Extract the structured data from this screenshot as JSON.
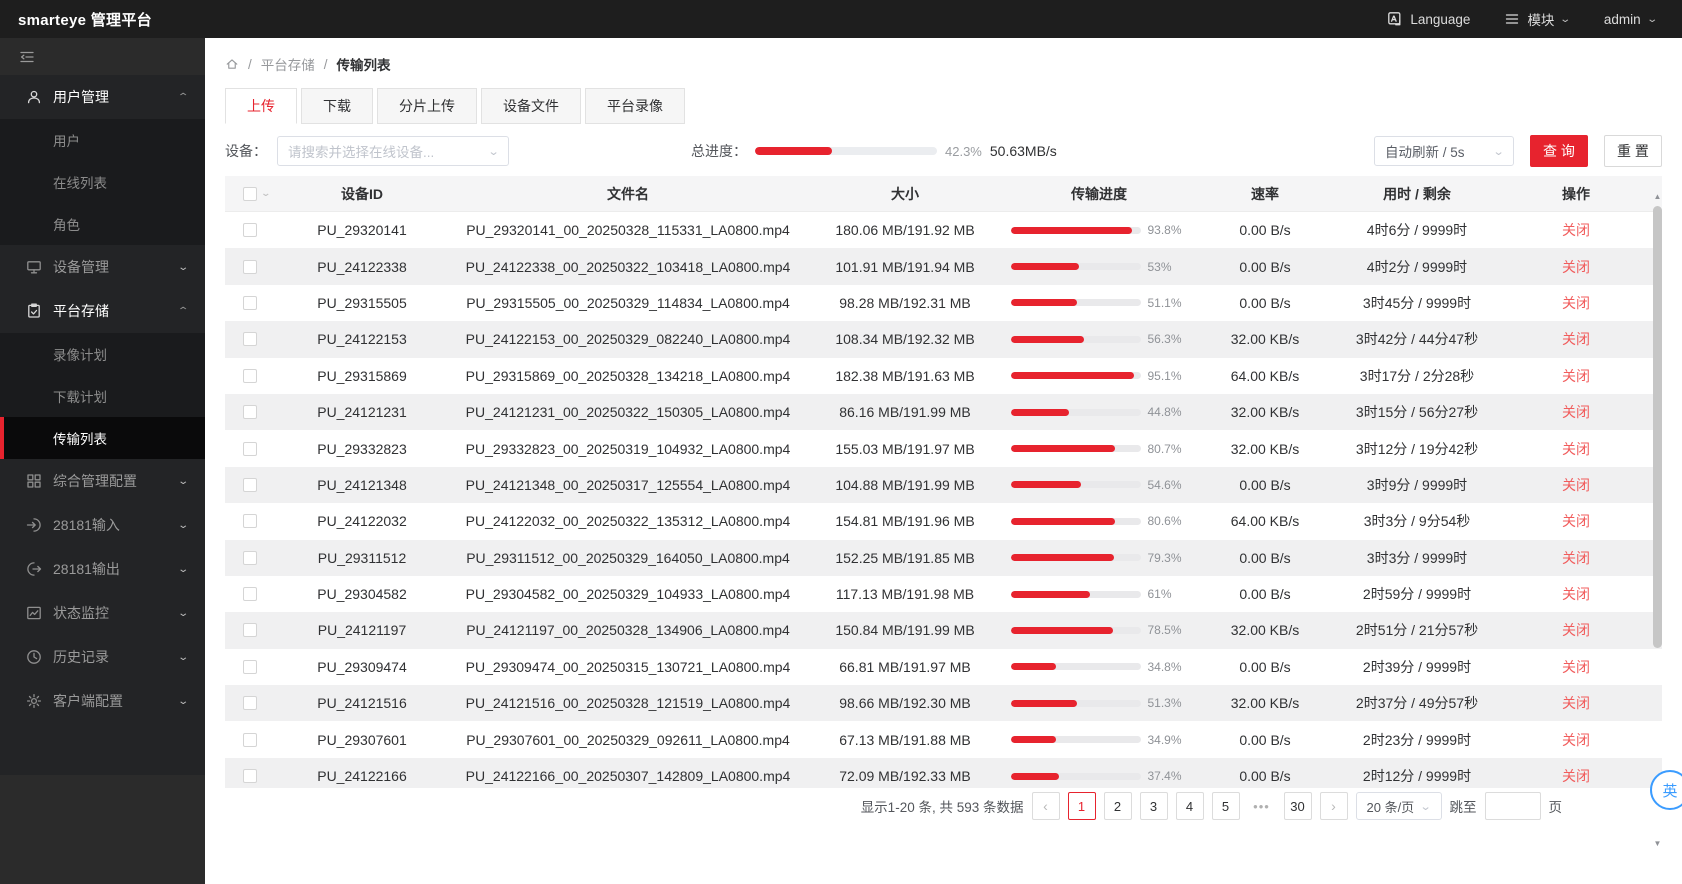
{
  "app": {
    "title": "smarteye 管理平台"
  },
  "topbar": {
    "language_label": "Language",
    "module_label": "模块",
    "user_name": "admin"
  },
  "colors": {
    "accent_red": "#e7232e",
    "soft_red": "#f15c5c",
    "link_blue": "#3b9cff",
    "topbar_bg": "#1e1e1e",
    "sidebar_bg": "#2b2b2b"
  },
  "icons": {
    "breadcrumb_sep": "/",
    "select_chevron": "∨",
    "collapse_chevron_up": "︿",
    "prev_page": "‹",
    "next_page": "›",
    "scroll_up": "▲",
    "scroll_down": "▼",
    "ellipsis": "•••"
  },
  "sidebar": {
    "items": [
      {
        "label": "用户管理",
        "expanded": true,
        "children": [
          {
            "label": "用户"
          },
          {
            "label": "在线列表"
          },
          {
            "label": "角色"
          }
        ]
      },
      {
        "label": "设备管理",
        "expanded": false
      },
      {
        "label": "平台存储",
        "expanded": true,
        "children": [
          {
            "label": "录像计划"
          },
          {
            "label": "下载计划"
          },
          {
            "label": "传输列表",
            "active": true
          }
        ]
      },
      {
        "label": "综合管理配置",
        "expanded": false
      },
      {
        "label": "28181输入",
        "expanded": false
      },
      {
        "label": "28181输出",
        "expanded": false
      },
      {
        "label": "状态监控",
        "expanded": false
      },
      {
        "label": "历史记录",
        "expanded": false
      },
      {
        "label": "客户端配置",
        "expanded": false
      }
    ]
  },
  "breadcrumb": {
    "items": [
      "平台存储",
      "传输列表"
    ]
  },
  "tabs": {
    "items": [
      "上传",
      "下载",
      "分片上传",
      "设备文件",
      "平台录像"
    ],
    "active": "上传"
  },
  "filters": {
    "device_label": "设备：",
    "device_placeholder": "请搜索并选择在线设备...",
    "total_progress_label": "总进度：",
    "total_progress_value": 42.3,
    "total_progress_percent": "42.3%",
    "total_speed": "50.63MB/s",
    "refresh_option": "自动刷新 / 5s",
    "query_label": "查 询",
    "reset_label": "重 置"
  },
  "table": {
    "columns": [
      "设备ID",
      "文件名",
      "大小",
      "传输进度",
      "速率",
      "用时 / 剩余",
      "操作"
    ],
    "action_label": "关闭",
    "rows": [
      {
        "device_id": "PU_29320141",
        "file_name": "PU_29320141_00_20250328_115331_LA0800.mp4",
        "size": "180.06 MB/191.92 MB",
        "progress": 93.8,
        "progress_label": "93.8%",
        "rate": "0.00 B/s",
        "time": "4时6分 / 9999时"
      },
      {
        "device_id": "PU_24122338",
        "file_name": "PU_24122338_00_20250322_103418_LA0800.mp4",
        "size": "101.91 MB/191.94 MB",
        "progress": 53,
        "progress_label": "53%",
        "rate": "0.00 B/s",
        "time": "4时2分 / 9999时"
      },
      {
        "device_id": "PU_29315505",
        "file_name": "PU_29315505_00_20250329_114834_LA0800.mp4",
        "size": "98.28 MB/192.31 MB",
        "progress": 51.1,
        "progress_label": "51.1%",
        "rate": "0.00 B/s",
        "time": "3时45分 / 9999时"
      },
      {
        "device_id": "PU_24122153",
        "file_name": "PU_24122153_00_20250329_082240_LA0800.mp4",
        "size": "108.34 MB/192.32 MB",
        "progress": 56.3,
        "progress_label": "56.3%",
        "rate": "32.00 KB/s",
        "time": "3时42分 / 44分47秒"
      },
      {
        "device_id": "PU_29315869",
        "file_name": "PU_29315869_00_20250328_134218_LA0800.mp4",
        "size": "182.38 MB/191.63 MB",
        "progress": 95.1,
        "progress_label": "95.1%",
        "rate": "64.00 KB/s",
        "time": "3时17分 / 2分28秒"
      },
      {
        "device_id": "PU_24121231",
        "file_name": "PU_24121231_00_20250322_150305_LA0800.mp4",
        "size": "86.16 MB/191.99 MB",
        "progress": 44.8,
        "progress_label": "44.8%",
        "rate": "32.00 KB/s",
        "time": "3时15分 / 56分27秒"
      },
      {
        "device_id": "PU_29332823",
        "file_name": "PU_29332823_00_20250319_104932_LA0800.mp4",
        "size": "155.03 MB/191.97 MB",
        "progress": 80.7,
        "progress_label": "80.7%",
        "rate": "32.00 KB/s",
        "time": "3时12分 / 19分42秒"
      },
      {
        "device_id": "PU_24121348",
        "file_name": "PU_24121348_00_20250317_125554_LA0800.mp4",
        "size": "104.88 MB/191.99 MB",
        "progress": 54.6,
        "progress_label": "54.6%",
        "rate": "0.00 B/s",
        "time": "3时9分 / 9999时"
      },
      {
        "device_id": "PU_24122032",
        "file_name": "PU_24122032_00_20250322_135312_LA0800.mp4",
        "size": "154.81 MB/191.96 MB",
        "progress": 80.6,
        "progress_label": "80.6%",
        "rate": "64.00 KB/s",
        "time": "3时3分 / 9分54秒"
      },
      {
        "device_id": "PU_29311512",
        "file_name": "PU_29311512_00_20250329_164050_LA0800.mp4",
        "size": "152.25 MB/191.85 MB",
        "progress": 79.3,
        "progress_label": "79.3%",
        "rate": "0.00 B/s",
        "time": "3时3分 / 9999时"
      },
      {
        "device_id": "PU_29304582",
        "file_name": "PU_29304582_00_20250329_104933_LA0800.mp4",
        "size": "117.13 MB/191.98 MB",
        "progress": 61,
        "progress_label": "61%",
        "rate": "0.00 B/s",
        "time": "2时59分 / 9999时"
      },
      {
        "device_id": "PU_24121197",
        "file_name": "PU_24121197_00_20250328_134906_LA0800.mp4",
        "size": "150.84 MB/191.99 MB",
        "progress": 78.5,
        "progress_label": "78.5%",
        "rate": "32.00 KB/s",
        "time": "2时51分 / 21分57秒"
      },
      {
        "device_id": "PU_29309474",
        "file_name": "PU_29309474_00_20250315_130721_LA0800.mp4",
        "size": "66.81 MB/191.97 MB",
        "progress": 34.8,
        "progress_label": "34.8%",
        "rate": "0.00 B/s",
        "time": "2时39分 / 9999时"
      },
      {
        "device_id": "PU_24121516",
        "file_name": "PU_24121516_00_20250328_121519_LA0800.mp4",
        "size": "98.66 MB/192.30 MB",
        "progress": 51.3,
        "progress_label": "51.3%",
        "rate": "32.00 KB/s",
        "time": "2时37分 / 49分57秒"
      },
      {
        "device_id": "PU_29307601",
        "file_name": "PU_29307601_00_20250329_092611_LA0800.mp4",
        "size": "67.13 MB/191.88 MB",
        "progress": 34.9,
        "progress_label": "34.9%",
        "rate": "0.00 B/s",
        "time": "2时23分 / 9999时"
      },
      {
        "device_id": "PU_24122166",
        "file_name": "PU_24122166_00_20250307_142809_LA0800.mp4",
        "size": "72.09 MB/192.33 MB",
        "progress": 37.4,
        "progress_label": "37.4%",
        "rate": "0.00 B/s",
        "time": "2时12分 / 9999时"
      }
    ]
  },
  "pagination": {
    "summary": "显示1-20 条, 共 593 条数据",
    "pages": [
      "1",
      "2",
      "3",
      "4",
      "5",
      "•••",
      "30"
    ],
    "current": "1",
    "page_size": "20 条/页",
    "jump_label": "跳至",
    "page_unit": "页"
  },
  "float_button": {
    "label": "英"
  }
}
